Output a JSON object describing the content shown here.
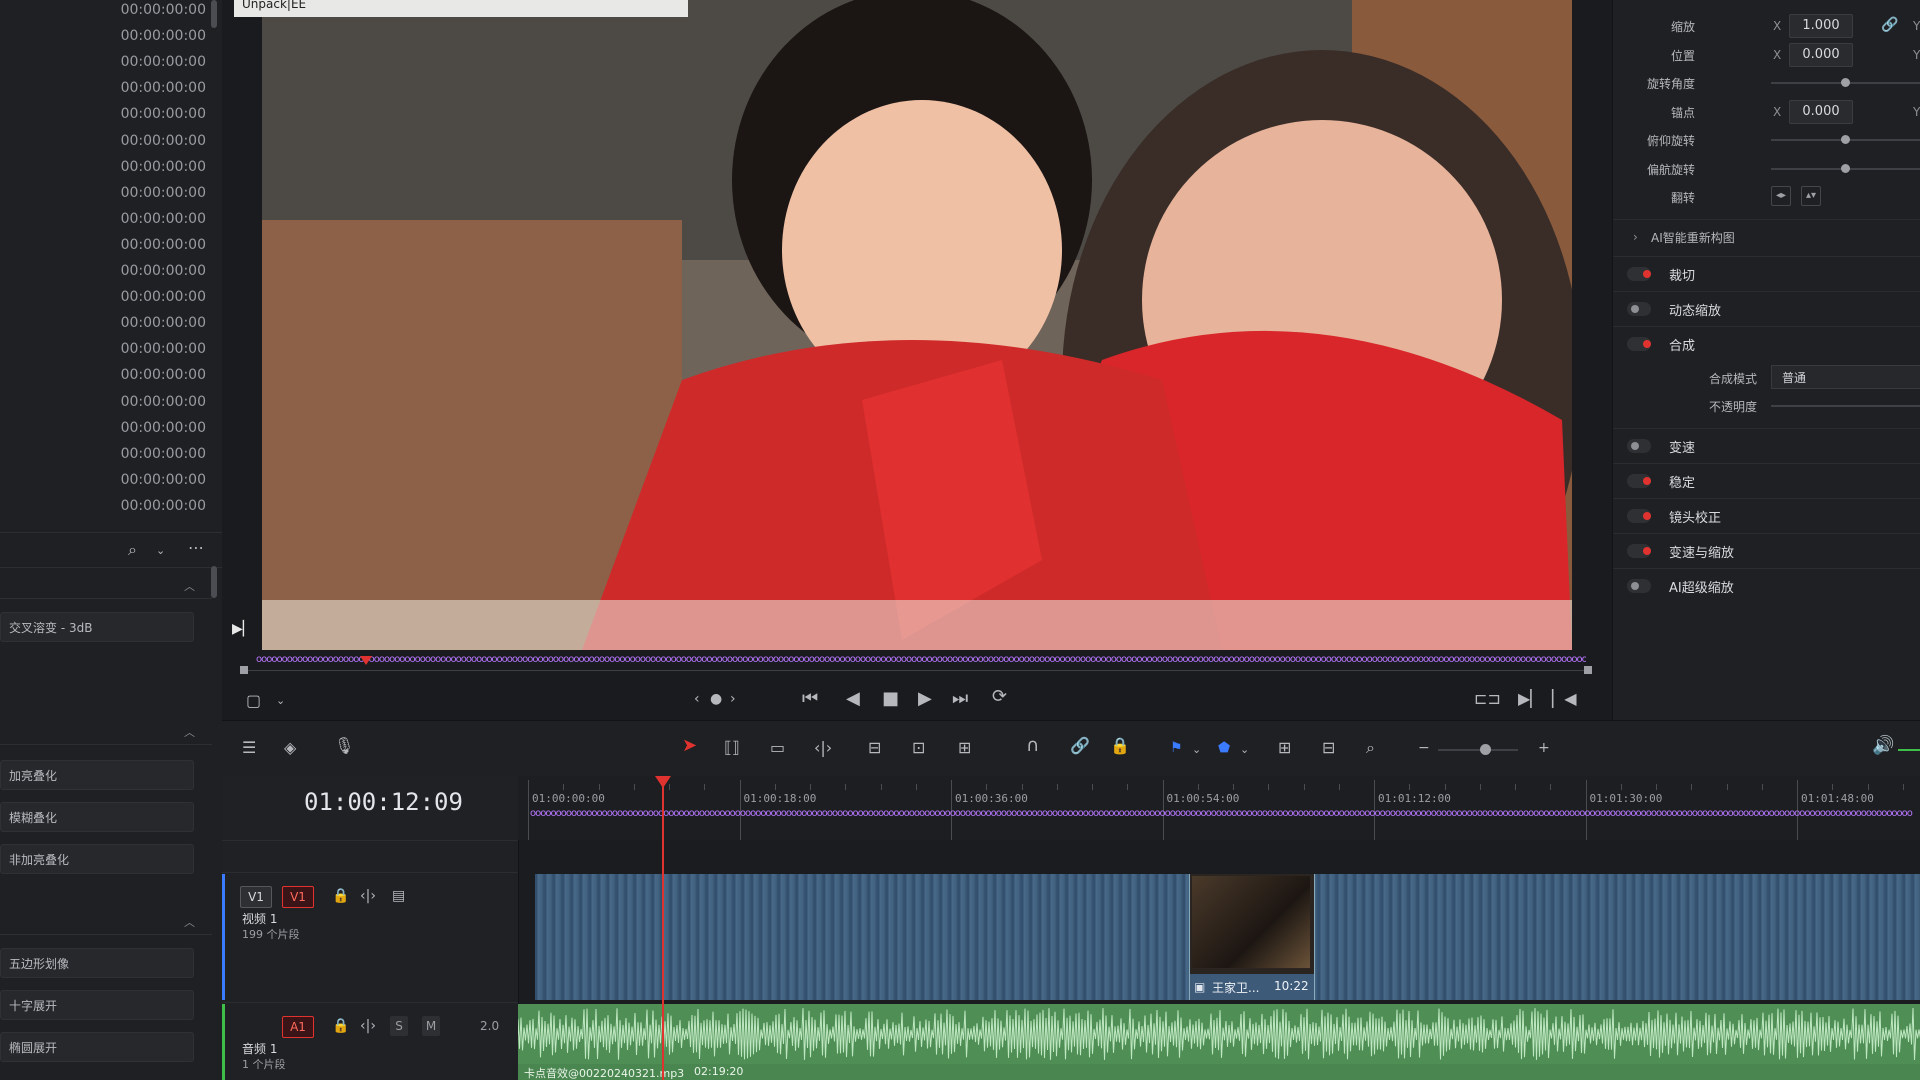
{
  "left_panel": {
    "timecodes": [
      "00:00:00:00",
      "00:00:00:00",
      "00:00:00:00",
      "00:00:00:00",
      "00:00:00:00",
      "00:00:00:00",
      "00:00:00:00",
      "00:00:00:00",
      "00:00:00:00",
      "00:00:00:00",
      "00:00:00:00",
      "00:00:00:00",
      "00:00:00:00",
      "00:00:00:00",
      "00:00:00:00",
      "00:00:00:00",
      "00:00:00:00",
      "00:00:00:00",
      "00:00:00:00",
      "00:00:00:00"
    ],
    "effects_group1": [
      "交叉溶变 - 3dB"
    ],
    "effects_group2": [
      "加亮叠化",
      "模糊叠化",
      "非加亮叠化"
    ],
    "effects_group3": [
      "五边形划像",
      "十字展开",
      "椭圆展开"
    ]
  },
  "viewer": {
    "clip_name": "Unpack|EE"
  },
  "inspector": {
    "zoom_label": "缩放",
    "zoom_x": "1.000",
    "position_label": "位置",
    "position_x": "0.000",
    "rotation_label": "旋转角度",
    "anchor_label": "锚点",
    "anchor_x": "0.000",
    "pitch_label": "俯仰旋转",
    "yaw_label": "偏航旋转",
    "flip_label": "翻转",
    "x_label": "X",
    "y_label": "Y",
    "ai_reframe_label": "AI智能重新构图",
    "sections": [
      {
        "label": "裁切",
        "active": true
      },
      {
        "label": "动态缩放",
        "active": false
      },
      {
        "label": "合成",
        "active": true
      },
      {
        "label": "变速",
        "active": false
      },
      {
        "label": "稳定",
        "active": true
      },
      {
        "label": "镜头校正",
        "active": true
      },
      {
        "label": "变速与缩放",
        "active": true
      },
      {
        "label": "AI超级缩放",
        "active": false
      }
    ],
    "composite_mode_label": "合成模式",
    "composite_mode_value": "普通",
    "opacity_label": "不透明度"
  },
  "timeline": {
    "timecode": "01:00:12:09",
    "ruler_labels": [
      "01:00:00:00",
      "01:00:18:00",
      "01:00:36:00",
      "01:00:54:00",
      "01:01:12:00",
      "01:01:30:00",
      "01:01:48:00"
    ],
    "video_track": {
      "badge_a": "V1",
      "badge_b": "V1",
      "name": "视频 1",
      "count": "199 个片段"
    },
    "audio_track": {
      "badge": "A1",
      "s": "S",
      "m": "M",
      "channels": "2.0",
      "name": "音频 1",
      "count": "1 个片段"
    },
    "clip_label": "王家卫...",
    "clip_duration": "10:22",
    "audio_clip_label": "卡点音效@00220240321.mp3",
    "audio_clip_duration": "02:19:20"
  },
  "colors": {
    "accent_red": "#e0332f",
    "marker_purple": "#b777ff",
    "video_clip": "#3d5a79",
    "audio_clip": "#4f8f55"
  }
}
